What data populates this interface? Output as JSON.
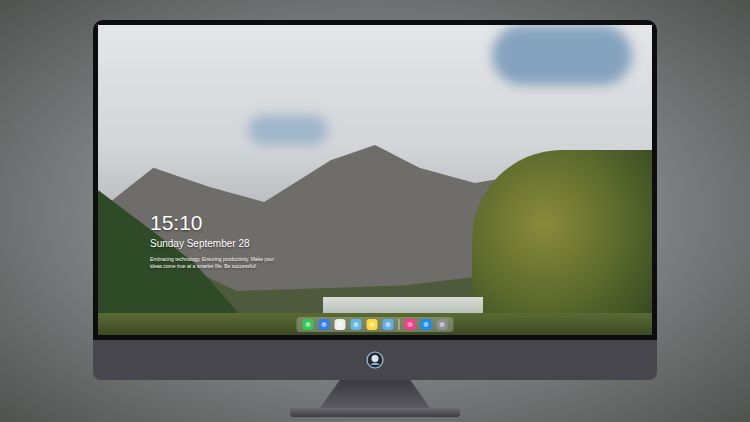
{
  "desktop": {
    "clock": "15:10",
    "date": "Sunday September 28",
    "motto": "Embracing technology, Ensuring productivity. Make your ideas come true at a smarter life. Be successful!"
  },
  "dock": {
    "items": [
      {
        "kind": "app",
        "color": "#34c759"
      },
      {
        "kind": "app",
        "color": "#2f7ff0"
      },
      {
        "kind": "app",
        "color": "#eeeeee"
      },
      {
        "kind": "app",
        "color": "#62b6e0"
      },
      {
        "kind": "app",
        "color": "#ffd83a"
      },
      {
        "kind": "app",
        "color": "#5fb0e8"
      },
      {
        "kind": "separator",
        "color": "#ffffff"
      },
      {
        "kind": "app",
        "color": "#fa3c8a"
      },
      {
        "kind": "app",
        "color": "#1c8cf5"
      },
      {
        "kind": "app",
        "color": "#8e8e93"
      }
    ]
  }
}
